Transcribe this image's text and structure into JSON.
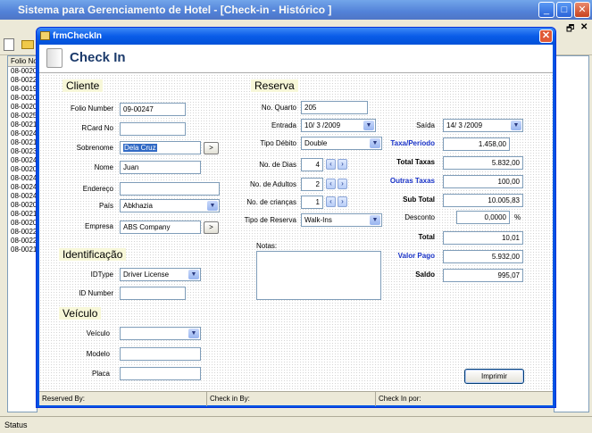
{
  "main": {
    "title": "Sistema para Gerenciamento de Hotel - [Check-in - Histórico ]",
    "list_header": "Folio No",
    "list_items": [
      "08-0020",
      "08-0022",
      "08-0019",
      "08-0020",
      "08-0020",
      "08-0025",
      "08-0021",
      "08-0024",
      "08-0021",
      "08-0023",
      "08-0024",
      "08-0020",
      "08-0024",
      "08-0024",
      "08-0024",
      "08-0020",
      "08-0021",
      "08-0020",
      "08-0022",
      "08-0022",
      "08-0021"
    ],
    "status": "Status"
  },
  "dialog": {
    "title": "frmCheckIn",
    "heading": "Check In",
    "cliente": {
      "section": "Cliente",
      "folio_label": "Folio Number",
      "folio_value": "09-00247",
      "rcard_label": "RCard No",
      "rcard_value": "",
      "sobrenome_label": "Sobrenome",
      "sobrenome_value": "Dela Cruz",
      "nome_label": "Nome",
      "nome_value": "Juan",
      "endereco_label": "Endereço",
      "endereco_value": "",
      "pais_label": "País",
      "pais_value": "Abkhazia",
      "empresa_label": "Empresa",
      "empresa_value": "ABS Company",
      "browse": ">"
    },
    "identificacao": {
      "section": "Identificação",
      "idtype_label": "IDType",
      "idtype_value": "Driver License",
      "idnumber_label": "ID Number",
      "idnumber_value": ""
    },
    "veiculo": {
      "section": "Veículo",
      "veiculo_label": "Veículo",
      "veiculo_value": "",
      "modelo_label": "Modelo",
      "modelo_value": "",
      "placa_label": "Placa",
      "placa_value": ""
    },
    "reserva": {
      "section": "Reserva",
      "quarto_label": "No. Quarto",
      "quarto_value": "205",
      "entrada_label": "Entrada",
      "entrada_value": "10/ 3 /2009",
      "tipo_debito_label": "Tipo Débito",
      "tipo_debito_value": "Double",
      "dias_label": "No. de Dias",
      "dias_value": "4",
      "adultos_label": "No. de Adultos",
      "adultos_value": "2",
      "criancas_label": "No. de crianças",
      "criancas_value": "1",
      "tipo_reserva_label": "Tipo de Reserva",
      "tipo_reserva_value": "Walk-Ins",
      "notas_label": "Notas:",
      "saida_label": "Saída",
      "saida_value": "14/ 3 /2009",
      "taxa_periodo_label": "Taxa/Período",
      "taxa_periodo_value": "1.458,00",
      "total_taxas_label": "Total Taxas",
      "total_taxas_value": "5.832,00",
      "outras_taxas_label": "Outras Taxas",
      "outras_taxas_value": "100,00",
      "sub_total_label": "Sub Total",
      "sub_total_value": "10.005,83",
      "desconto_label": "Desconto",
      "desconto_value": "0,0000",
      "desconto_unit": "%",
      "total_label": "Total",
      "total_value": "10,01",
      "valor_pago_label": "Valor Pago",
      "valor_pago_value": "5.932,00",
      "saldo_label": "Saldo",
      "saldo_value": "995,07"
    },
    "print_button": "Imprimir",
    "status": {
      "reserved_by": "Reserved By:",
      "checkin_by": "Check in By:",
      "checkin_por": "Check In por:"
    }
  },
  "colors": {
    "accent_blue": "#1a33c8",
    "title_blue": "#0a5ce8",
    "close_red": "#e05a37"
  }
}
